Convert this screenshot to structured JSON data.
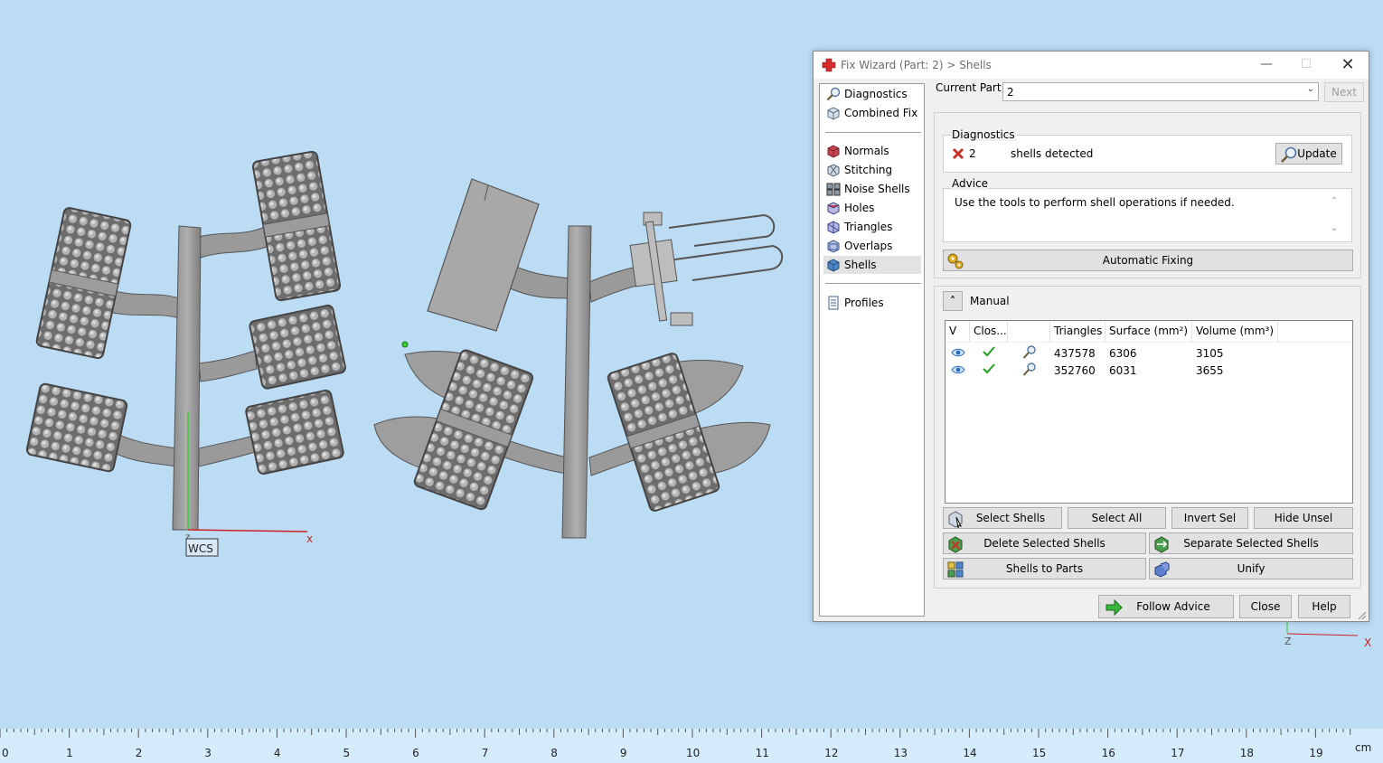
{
  "dialog": {
    "title": "Fix Wizard (Part: 2) > Shells",
    "controls": {
      "minimize": "—",
      "maximize": "☐",
      "close": "✕"
    }
  },
  "nav": {
    "items": [
      {
        "label": "Diagnostics",
        "icon": "magnifier-icon"
      },
      {
        "label": "Combined Fix",
        "icon": "cube-icon"
      },
      {
        "label": "Normals",
        "icon": "normals-icon"
      },
      {
        "label": "Stitching",
        "icon": "stitching-icon"
      },
      {
        "label": "Noise Shells",
        "icon": "noise-shells-icon"
      },
      {
        "label": "Holes",
        "icon": "holes-icon"
      },
      {
        "label": "Triangles",
        "icon": "triangles-icon"
      },
      {
        "label": "Overlaps",
        "icon": "overlaps-icon"
      },
      {
        "label": "Shells",
        "icon": "shells-icon"
      },
      {
        "label": "Profiles",
        "icon": "profiles-icon"
      }
    ],
    "active": "Shells"
  },
  "current_part": {
    "label": "Current Part:",
    "value": "2",
    "next_label": "Next"
  },
  "diagnostics": {
    "title": "Diagnostics",
    "count": "2",
    "text": "shells detected",
    "update_label": "Update"
  },
  "advice": {
    "title": "Advice",
    "text": "Use the tools to perform shell operations if needed."
  },
  "automatic_fixing_label": "Automatic Fixing",
  "manual": {
    "title": "Manual",
    "columns": [
      "V",
      "Clos...",
      "",
      "Triangles",
      "Surface (mm²)",
      "Volume (mm³)"
    ],
    "rows": [
      {
        "triangles": "437578",
        "surface": "6306",
        "volume": "3105"
      },
      {
        "triangles": "352760",
        "surface": "6031",
        "volume": "3655"
      }
    ],
    "buttons": {
      "select_shells": "Select Shells",
      "select_all": "Select All",
      "invert_sel": "Invert Sel",
      "hide_unsel": "Hide Unsel",
      "delete_selected": "Delete Selected Shells",
      "separate_selected": "Separate Selected Shells",
      "shells_to_parts": "Shells to Parts",
      "unify": "Unify"
    }
  },
  "footer": {
    "follow_advice": "Follow Advice",
    "close": "Close",
    "help": "Help"
  },
  "viewport": {
    "wcs_label": "WCS",
    "axis_x": "x",
    "axis_z": "z",
    "mini_axis_x": "X",
    "mini_axis_z": "Z"
  },
  "ruler": {
    "labels": [
      "0",
      "1",
      "2",
      "3",
      "4",
      "5",
      "6",
      "7",
      "8",
      "9",
      "10",
      "11",
      "12",
      "13",
      "14",
      "15",
      "16",
      "17",
      "18",
      "19"
    ],
    "unit": "cm"
  },
  "colors": {
    "background": "#bcdcf4",
    "model": "#8c8c8c",
    "accent_red": "#d42a2a",
    "check_green": "#22a022"
  }
}
